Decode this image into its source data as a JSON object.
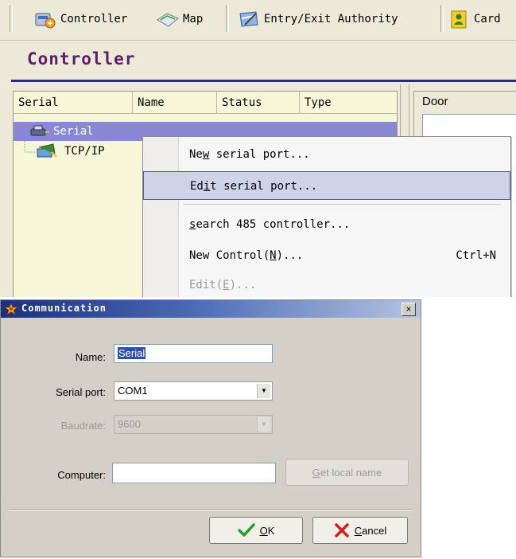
{
  "toolbar": {
    "items": [
      {
        "label": "Controller",
        "icon": "controller-icon"
      },
      {
        "label": "Map",
        "icon": "map-icon"
      },
      {
        "label": "Entry/Exit Authority",
        "icon": "authority-icon"
      },
      {
        "label": "Card",
        "icon": "card-icon"
      }
    ]
  },
  "page": {
    "title": "Controller"
  },
  "list": {
    "columns": [
      "Serial",
      "Name",
      "Status",
      "Type"
    ],
    "tree": [
      {
        "label": "Serial",
        "selected": true
      },
      {
        "label": "TCP/IP",
        "selected": false
      }
    ]
  },
  "door_panel": {
    "header": "Door"
  },
  "context_menu": {
    "items": [
      {
        "pre": "Ne",
        "key": "w",
        "post": " serial port...",
        "shortcut": ""
      },
      {
        "pre": "Ed",
        "key": "i",
        "post": "t serial port...",
        "shortcut": ""
      },
      {
        "pre": "",
        "key": "s",
        "post": "earch 485 controller...",
        "shortcut": ""
      },
      {
        "pre": "New Control(",
        "key": "N",
        "post": ")...",
        "shortcut": "Ctrl+N"
      },
      {
        "pre": "Edit(",
        "key": "E",
        "post": ")...",
        "shortcut": ""
      }
    ]
  },
  "dialog": {
    "title": "Communication",
    "close": "×",
    "name_label": "Name:",
    "name_value": "Serial",
    "serial_port_label": "Serial port:",
    "serial_port_value": "COM1",
    "baudrate_label": "Baudrate:",
    "baudrate_value": "9600",
    "computer_label": "Computer:",
    "computer_value": "",
    "get_local_pre": "",
    "get_local_key": "G",
    "get_local_post": "et local name",
    "ok_key": "O",
    "ok_post": "K",
    "cancel_key": "C",
    "cancel_post": "ancel"
  },
  "colors": {
    "selection": "#8a88d4",
    "title_purple": "#5a1f6b",
    "rule_navy": "#2a2a8c",
    "dialog_title": "#1c2f7e"
  }
}
